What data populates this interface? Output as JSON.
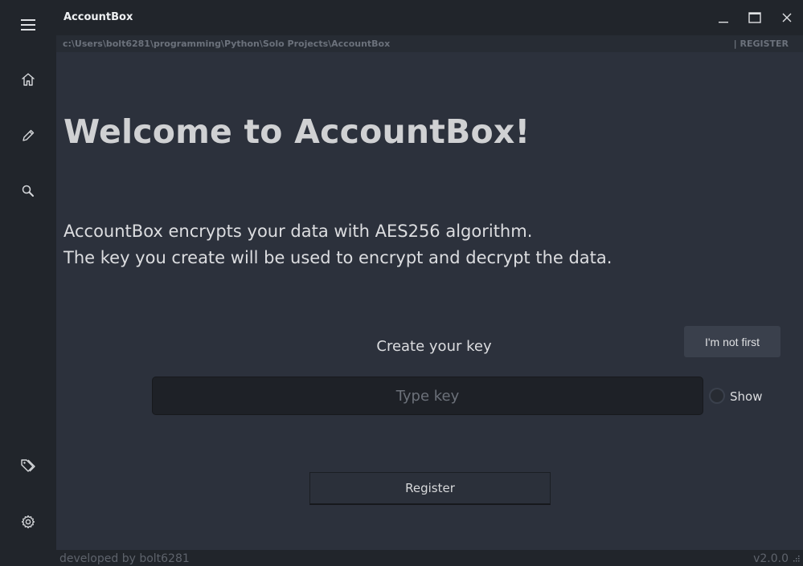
{
  "window": {
    "title": "AccountBox",
    "path": "c:\\Users\\bolt6281\\programming\\Python\\Solo Projects\\AccountBox",
    "page_label": "| REGISTER"
  },
  "sidebar": {
    "items": [
      {
        "icon": "hamburger-menu-icon"
      },
      {
        "icon": "home-icon"
      },
      {
        "icon": "pencil-icon"
      },
      {
        "icon": "search-icon"
      },
      {
        "icon": "tags-icon"
      },
      {
        "icon": "gear-icon"
      }
    ]
  },
  "main": {
    "heading": "Welcome to AccountBox!",
    "description_line1": "AccountBox encrypts your data with AES256 algorithm.",
    "description_line2": "The key you create will be used to encrypt and decrypt the data.",
    "not_first_label": "I'm not first",
    "create_key_label": "Create your key",
    "key_placeholder": "Type key",
    "key_value": "",
    "show_label": "Show",
    "register_label": "Register"
  },
  "footer": {
    "developer": "developed by bolt6281",
    "version": "v2.0.0"
  },
  "colors": {
    "sidebar_bg": "#21252b",
    "content_bg": "#2c313c",
    "input_bg": "#1e2127",
    "button_bg": "#3a404c"
  }
}
